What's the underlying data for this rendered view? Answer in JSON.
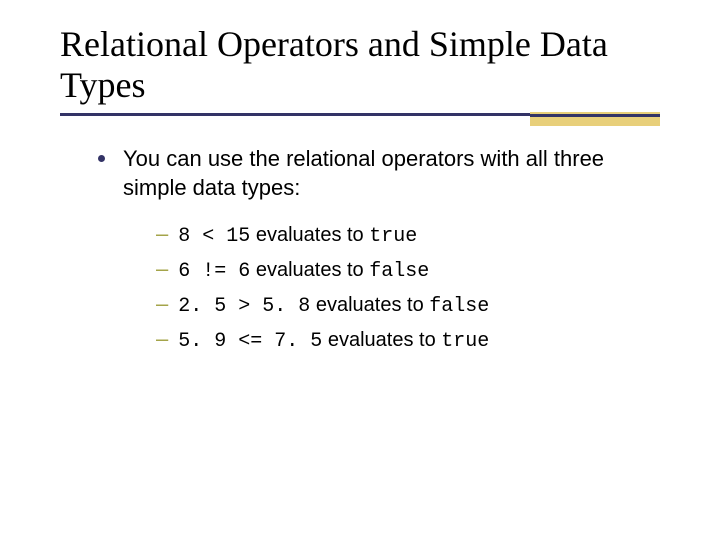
{
  "title": "Relational Operators and Simple Data Types",
  "bullet": "You can use the relational operators with all three simple data types:",
  "items": [
    {
      "expr": "8 < 15",
      "mid": " evaluates to ",
      "result": "true"
    },
    {
      "expr": "6 != 6",
      "mid": " evaluates to ",
      "result": "false"
    },
    {
      "expr": "2. 5 > 5. 8",
      "mid": " evaluates to ",
      "result": "false"
    },
    {
      "expr": "5. 9 <= 7. 5",
      "mid": " evaluates to ",
      "result": "true"
    }
  ]
}
